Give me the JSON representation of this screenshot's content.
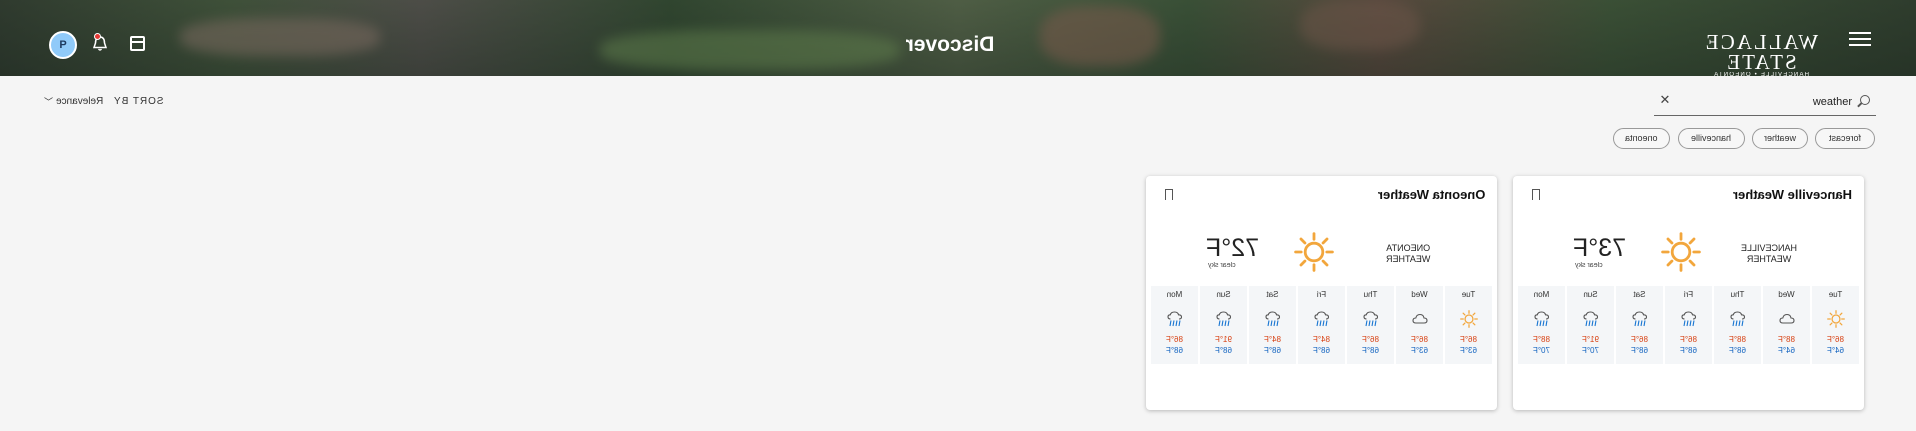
{
  "header": {
    "logo_name": "WALLACE STATE",
    "logo_sub": "HANCEVILLE • ONEONTA",
    "page_title": "Discover",
    "avatar_initial": "P",
    "icons": {
      "menu": "menu-icon",
      "calendar": "calendar-icon",
      "bell": "bell-icon"
    }
  },
  "search": {
    "value": "weather",
    "placeholder": "Search"
  },
  "sort": {
    "label": "SORT BY",
    "value": "Relevance"
  },
  "chips": [
    "forecast",
    "weather",
    "hanceville",
    "oneonta"
  ],
  "cards": [
    {
      "title": "Hanceville Weather",
      "location": "HANCEVILLE",
      "location_sub": "WEATHER",
      "temp": "73°F",
      "condition": "clear sky",
      "days": [
        {
          "name": "Tue",
          "icon": "sun",
          "hi": "86°F",
          "lo": "64°F"
        },
        {
          "name": "Wed",
          "icon": "cloud",
          "hi": "88°F",
          "lo": "64°F"
        },
        {
          "name": "Thu",
          "icon": "rain",
          "hi": "88°F",
          "lo": "68°F"
        },
        {
          "name": "Fri",
          "icon": "rain",
          "hi": "86°F",
          "lo": "68°F"
        },
        {
          "name": "Sat",
          "icon": "rain",
          "hi": "86°F",
          "lo": "68°F"
        },
        {
          "name": "Sun",
          "icon": "rain",
          "hi": "91°F",
          "lo": "70°F"
        },
        {
          "name": "Mon",
          "icon": "rain",
          "hi": "88°F",
          "lo": "70°F"
        }
      ]
    },
    {
      "title": "Oneonta Weather",
      "location": "ONEONTA",
      "location_sub": "WEATHER",
      "temp": "72°F",
      "condition": "clear sky",
      "days": [
        {
          "name": "Tue",
          "icon": "sun",
          "hi": "86°F",
          "lo": "63°F"
        },
        {
          "name": "Wed",
          "icon": "cloud",
          "hi": "86°F",
          "lo": "63°F"
        },
        {
          "name": "Thu",
          "icon": "rain",
          "hi": "86°F",
          "lo": "68°F"
        },
        {
          "name": "Fri",
          "icon": "rain",
          "hi": "84°F",
          "lo": "68°F"
        },
        {
          "name": "Sat",
          "icon": "rain",
          "hi": "84°F",
          "lo": "68°F"
        },
        {
          "name": "Sun",
          "icon": "rain",
          "hi": "91°F",
          "lo": "68°F"
        },
        {
          "name": "Mon",
          "icon": "rain",
          "hi": "86°F",
          "lo": "68°F"
        }
      ]
    }
  ],
  "colors": {
    "sun": "#f2a63c",
    "hi": "#d84315",
    "lo": "#1565c0",
    "avatar": "#90caf9"
  }
}
